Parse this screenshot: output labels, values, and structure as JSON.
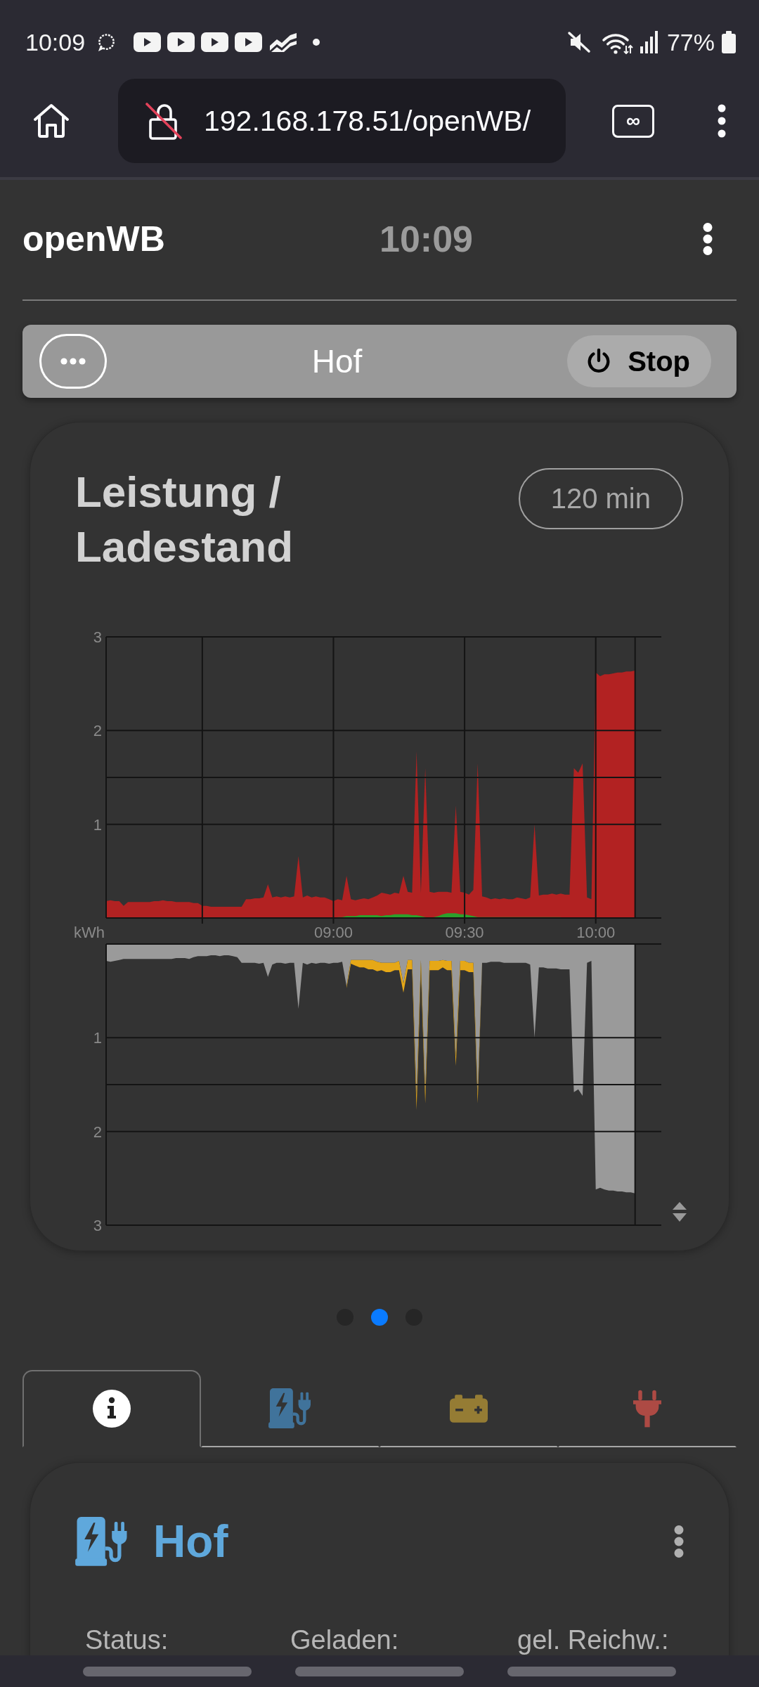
{
  "status_bar": {
    "time": "10:09",
    "battery": "77%"
  },
  "browser": {
    "url": "192.168.178.51/openWB/",
    "tab_count": "∞"
  },
  "header": {
    "title": "openWB",
    "clock": "10:09"
  },
  "chargepoint_bar": {
    "name": "Hof",
    "stop_button": "Stop"
  },
  "chart_card": {
    "title": "Leistung / Ladestand",
    "range_button": "120 min",
    "charts": [
      {
        "chart_data": {
          "type": "area",
          "ylabel": "kWh",
          "stacked": false,
          "grid": true,
          "xlim": [
            488,
            615
          ],
          "ylim": [
            0,
            3
          ],
          "xticks": [
            {
              "value": 540,
              "label": "09:00"
            },
            {
              "value": 570,
              "label": "09:30"
            },
            {
              "value": 600,
              "label": "10:00"
            }
          ],
          "yticks": [
            1,
            2,
            3
          ],
          "x": [
            488,
            489,
            490,
            491,
            492,
            493,
            494,
            495,
            496,
            497,
            498,
            499,
            500,
            501,
            502,
            503,
            504,
            505,
            506,
            507,
            508,
            509,
            510,
            511,
            512,
            513,
            514,
            515,
            516,
            517,
            518,
            519,
            520,
            521,
            522,
            523,
            524,
            525,
            526,
            527,
            528,
            529,
            530,
            531,
            532,
            533,
            534,
            535,
            536,
            537,
            538,
            539,
            540,
            541,
            542,
            543,
            544,
            545,
            546,
            547,
            548,
            549,
            550,
            551,
            552,
            553,
            554,
            555,
            556,
            557,
            558,
            559,
            560,
            561,
            562,
            563,
            564,
            565,
            566,
            567,
            568,
            569,
            570,
            571,
            572,
            573,
            574,
            575,
            576,
            577,
            578,
            579,
            580,
            581,
            582,
            583,
            584,
            585,
            586,
            587,
            588,
            589,
            590,
            591,
            592,
            593,
            594,
            595,
            596,
            597,
            598,
            599,
            600,
            601,
            602,
            603,
            604,
            605,
            606,
            607,
            608,
            609
          ],
          "series": [
            {
              "color": "#b22222",
              "values": [
                0.18,
                0.19,
                0.18,
                0.18,
                0.13,
                0.17,
                0.17,
                0.17,
                0.17,
                0.17,
                0.17,
                0.18,
                0.18,
                0.19,
                0.18,
                0.18,
                0.17,
                0.17,
                0.17,
                0.17,
                0.16,
                0.16,
                0.13,
                0.13,
                0.12,
                0.12,
                0.12,
                0.12,
                0.12,
                0.12,
                0.12,
                0.12,
                0.2,
                0.2,
                0.21,
                0.21,
                0.22,
                0.36,
                0.22,
                0.23,
                0.22,
                0.23,
                0.22,
                0.23,
                0.66,
                0.22,
                0.24,
                0.22,
                0.23,
                0.22,
                0.22,
                0.2,
                0.18,
                0.2,
                0.19,
                0.45,
                0.2,
                0.19,
                0.2,
                0.21,
                0.2,
                0.22,
                0.24,
                0.27,
                0.26,
                0.25,
                0.27,
                0.26,
                0.45,
                0.28,
                0.27,
                1.78,
                0.27,
                1.6,
                0.28,
                0.27,
                0.28,
                0.28,
                0.28,
                0.27,
                1.2,
                0.28,
                0.27,
                0.25,
                0.3,
                1.65,
                0.23,
                0.22,
                0.2,
                0.21,
                0.2,
                0.21,
                0.2,
                0.2,
                0.22,
                0.21,
                0.2,
                0.22,
                1.0,
                0.24,
                0.25,
                0.25,
                0.26,
                0.25,
                0.26,
                0.25,
                0.25,
                1.6,
                1.55,
                1.65,
                0.22,
                0.2,
                2.62,
                2.58,
                2.6,
                2.6,
                2.61,
                2.62,
                2.62,
                2.63,
                2.63,
                2.64
              ]
            },
            {
              "color": "#2ca02c",
              "values": [
                null,
                null,
                null,
                null,
                null,
                null,
                null,
                null,
                null,
                null,
                null,
                null,
                null,
                null,
                null,
                null,
                null,
                null,
                null,
                null,
                null,
                null,
                null,
                null,
                null,
                null,
                null,
                null,
                null,
                null,
                null,
                null,
                null,
                null,
                null,
                null,
                null,
                null,
                null,
                null,
                null,
                null,
                null,
                null,
                null,
                null,
                null,
                null,
                null,
                null,
                null,
                null,
                null,
                0.01,
                0.01,
                0.02,
                0.02,
                0.02,
                0.03,
                0.03,
                0.03,
                0.03,
                0.03,
                0.02,
                0.03,
                0.03,
                0.04,
                0.04,
                0.04,
                0.04,
                0.03,
                0.03,
                0.02,
                0.01,
                0,
                0.01,
                0.02,
                0.04,
                0.05,
                0.05,
                0.05,
                0.04,
                0.04,
                0.03,
                0.02,
                0.01,
                0.01,
                0.01,
                0.01,
                0.01,
                0.01,
                0.01,
                0.01,
                0.01,
                0.01,
                0.01,
                0.01,
                0.01,
                0.01,
                0.01,
                0.01,
                0.01,
                0.01,
                0.01,
                0.01,
                null,
                null,
                null,
                null,
                null,
                null,
                null,
                null,
                null,
                null,
                null,
                null,
                null,
                null,
                null,
                null,
                null
              ]
            }
          ]
        }
      },
      {
        "chart_data": {
          "type": "area",
          "stacked": true,
          "grid": true,
          "xlim": [
            488,
            615
          ],
          "ylim": [
            3,
            0
          ],
          "yticks": [
            1,
            2,
            3
          ],
          "x": [
            488,
            489,
            490,
            491,
            492,
            493,
            494,
            495,
            496,
            497,
            498,
            499,
            500,
            501,
            502,
            503,
            504,
            505,
            506,
            507,
            508,
            509,
            510,
            511,
            512,
            513,
            514,
            515,
            516,
            517,
            518,
            519,
            520,
            521,
            522,
            523,
            524,
            525,
            526,
            527,
            528,
            529,
            530,
            531,
            532,
            533,
            534,
            535,
            536,
            537,
            538,
            539,
            540,
            541,
            542,
            543,
            544,
            545,
            546,
            547,
            548,
            549,
            550,
            551,
            552,
            553,
            554,
            555,
            556,
            557,
            558,
            559,
            560,
            561,
            562,
            563,
            564,
            565,
            566,
            567,
            568,
            569,
            570,
            571,
            572,
            573,
            574,
            575,
            576,
            577,
            578,
            579,
            580,
            581,
            582,
            583,
            584,
            585,
            586,
            587,
            588,
            589,
            590,
            591,
            592,
            593,
            594,
            595,
            596,
            597,
            598,
            599,
            600,
            601,
            602,
            603,
            604,
            605,
            606,
            607,
            608,
            609
          ],
          "series": [
            {
              "color": "#9a9a9a",
              "values": [
                0.18,
                0.19,
                0.18,
                0.17,
                0.16,
                0.16,
                0.16,
                0.16,
                0.16,
                0.16,
                0.16,
                0.16,
                0.16,
                0.16,
                0.16,
                0.16,
                0.15,
                0.15,
                0.15,
                0.16,
                0.14,
                0.13,
                0.13,
                0.13,
                0.12,
                0.12,
                0.13,
                0.12,
                0.12,
                0.13,
                0.14,
                0.2,
                0.2,
                0.2,
                0.2,
                0.21,
                0.2,
                0.35,
                0.22,
                0.2,
                0.2,
                0.21,
                0.2,
                0.2,
                0.69,
                0.2,
                0.22,
                0.2,
                0.21,
                0.2,
                0.2,
                0.21,
                0.2,
                0.2,
                0.19,
                0.45,
                0.17,
                0.17,
                0.17,
                0.17,
                0.17,
                0.17,
                0.19,
                0.2,
                0.2,
                0.2,
                0.2,
                0.18,
                0.42,
                0.17,
                0.17,
                1.62,
                0.17,
                1.58,
                0.18,
                0.18,
                0.18,
                0.17,
                0.18,
                0.18,
                1.2,
                0.18,
                0.18,
                0.2,
                0.2,
                1.6,
                0.2,
                0.2,
                0.19,
                0.19,
                0.19,
                0.2,
                0.2,
                0.2,
                0.2,
                0.2,
                0.2,
                0.22,
                1.0,
                0.25,
                0.25,
                0.26,
                0.26,
                0.26,
                0.27,
                0.27,
                0.27,
                1.58,
                1.55,
                1.62,
                0.2,
                0.18,
                2.62,
                2.6,
                2.62,
                2.63,
                2.63,
                2.64,
                2.64,
                2.65,
                2.65,
                2.66
              ]
            },
            {
              "color": "#e6a817",
              "values": [
                null,
                null,
                null,
                null,
                null,
                null,
                null,
                null,
                null,
                null,
                null,
                null,
                null,
                null,
                null,
                null,
                null,
                null,
                null,
                null,
                null,
                null,
                null,
                null,
                null,
                null,
                null,
                null,
                null,
                null,
                null,
                null,
                null,
                null,
                null,
                null,
                null,
                null,
                null,
                null,
                null,
                null,
                null,
                null,
                null,
                null,
                null,
                null,
                null,
                null,
                null,
                null,
                null,
                null,
                null,
                0.02,
                0.04,
                0.06,
                0.08,
                0.08,
                0.1,
                0.1,
                0.1,
                0.08,
                0.1,
                0.1,
                0.08,
                0.1,
                0.1,
                0.1,
                0.1,
                0.15,
                0.1,
                0.12,
                0.1,
                0.1,
                0.1,
                0.08,
                0.1,
                0.1,
                0.1,
                0.1,
                0.1,
                0.1,
                0.1,
                0.1,
                0.02,
                null,
                null,
                null,
                null,
                null,
                null,
                null,
                null,
                null,
                null,
                null,
                null,
                null,
                null,
                null,
                null,
                null,
                null,
                null,
                null,
                null,
                null,
                null,
                null,
                null,
                null,
                null,
                null,
                null,
                null,
                null,
                null,
                null,
                null,
                null
              ]
            }
          ]
        }
      }
    ]
  },
  "pager": {
    "dots": [
      {
        "selected": false
      },
      {
        "selected": true
      },
      {
        "selected": false
      }
    ]
  },
  "tabs": [
    {
      "kind": "info",
      "selected": true
    },
    {
      "kind": "chargepoint",
      "selected": false
    },
    {
      "kind": "battery",
      "selected": false
    },
    {
      "kind": "plug",
      "selected": false
    }
  ],
  "chargepoint_card": {
    "name": "Hof",
    "labels": [
      "Status:",
      "Geladen:",
      "gel. Reichw.:"
    ]
  }
}
